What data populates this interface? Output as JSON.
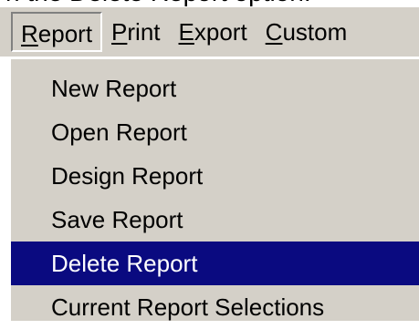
{
  "caption": "n the Delete Report option.",
  "menubar": {
    "items": [
      {
        "label": "Report",
        "mnemonic": "R",
        "rest": "eport",
        "open": true
      },
      {
        "label": "Print",
        "mnemonic": "P",
        "rest": "rint",
        "open": false
      },
      {
        "label": "Export",
        "mnemonic": "E",
        "rest": "xport",
        "open": false
      },
      {
        "label": "Custom",
        "mnemonic": "C",
        "rest": "ustom",
        "open": false
      }
    ]
  },
  "dropdown": {
    "items": [
      {
        "label": "New Report"
      },
      {
        "label": "Open Report"
      },
      {
        "label": "Design Report"
      },
      {
        "label": "Save Report"
      },
      {
        "label": "Delete Report",
        "selected": true
      },
      {
        "label": "Current Report Selections"
      }
    ]
  },
  "colors": {
    "menu_background": "#d4d0c8",
    "selection_background": "#0a0a80",
    "selection_text": "#ffffff"
  }
}
